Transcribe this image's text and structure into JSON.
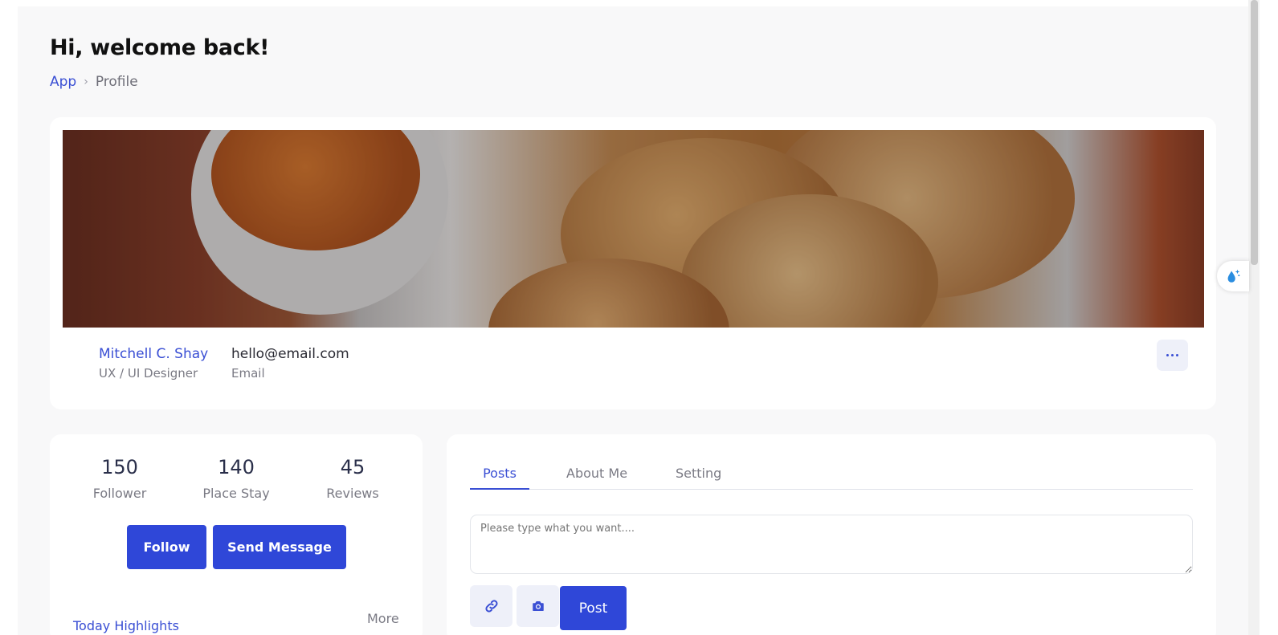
{
  "page": {
    "title": "Hi, welcome back!",
    "breadcrumb": {
      "root": "App",
      "separator": "›",
      "current": "Profile"
    }
  },
  "profile": {
    "cover_image": "food-photo-medu-vada-with-chutney",
    "name": "Mitchell C. Shay",
    "role": "UX / UI Designer",
    "email": "hello@email.com",
    "email_label": "Email",
    "more_icon": "ellipsis-horizontal-icon"
  },
  "stats": [
    {
      "value": "150",
      "label": "Follower"
    },
    {
      "value": "140",
      "label": "Place Stay"
    },
    {
      "value": "45",
      "label": "Reviews"
    }
  ],
  "actions": {
    "follow_label": "Follow",
    "message_label": "Send Message"
  },
  "highlights": {
    "title": "Today Highlights",
    "more_label": "More"
  },
  "posts": {
    "tabs": [
      {
        "label": "Posts",
        "active": true
      },
      {
        "label": "About Me",
        "active": false
      },
      {
        "label": "Setting",
        "active": false
      }
    ],
    "textarea_placeholder": "Please type what you want....",
    "link_icon": "link-icon",
    "camera_icon": "camera-icon",
    "post_label": "Post"
  },
  "colors": {
    "accent": "#2f47d8",
    "link": "#3a4fd4",
    "background": "#f8f8f9",
    "card": "#ffffff",
    "muted_text": "#7a7a84",
    "icon_button_bg": "#eef0f9"
  }
}
